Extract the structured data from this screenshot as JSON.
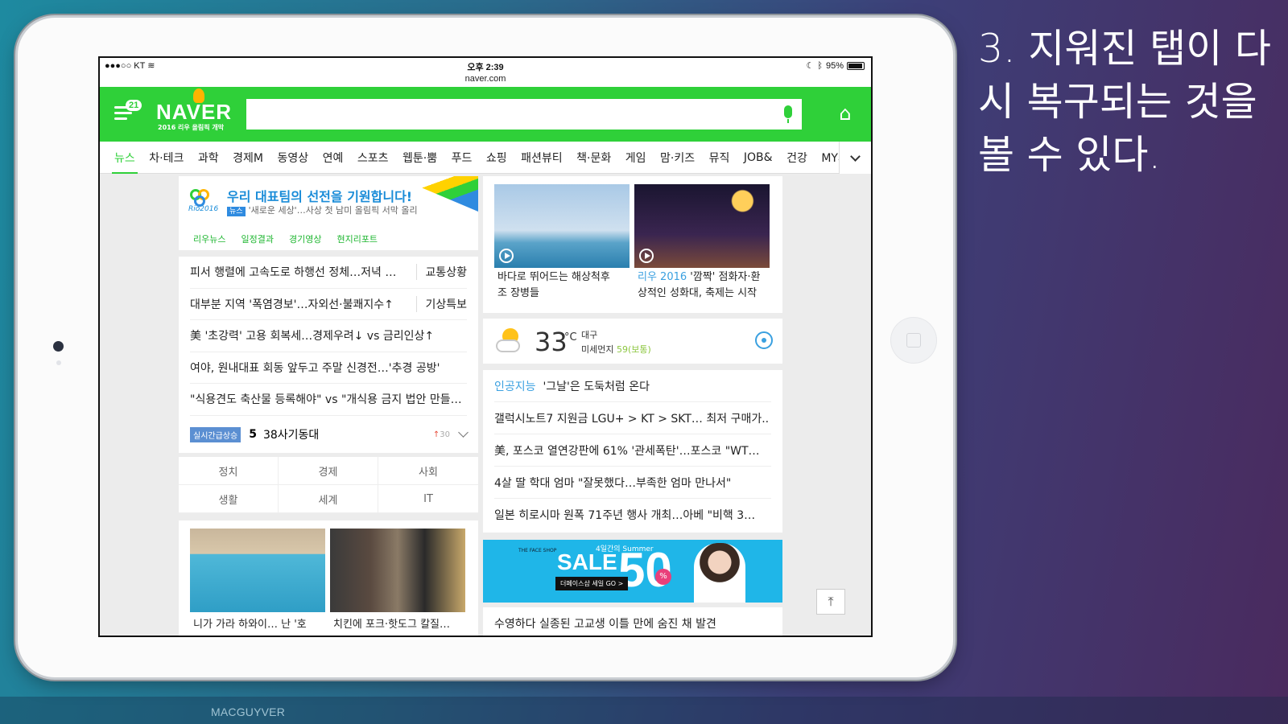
{
  "caption": "3. 지워진 탭이 다시 복구되는 것을 볼 수 있다.",
  "footer": "MACGUYVER",
  "statusbar": {
    "carrier": "●●●○○ KT",
    "time": "오후 2:39",
    "battery": "95%",
    "battery_level": 0.95
  },
  "url": "naver.com",
  "header": {
    "logo": "NAVER",
    "logo_sub": "2016 리우 올림픽 개막",
    "menu_badge": "21",
    "search_placeholder": ""
  },
  "tabs": [
    "뉴스",
    "차·테크",
    "과학",
    "경제M",
    "동영상",
    "연예",
    "스포츠",
    "웹툰·뿜",
    "푸드",
    "쇼핑",
    "패션뷰티",
    "책·문화",
    "게임",
    "맘·키즈",
    "뮤직",
    "JOB&",
    "건강",
    "MY피드"
  ],
  "rio": {
    "logo_text": "Rio2016",
    "title": "우리 대표팀의 선전을 기원합니다!",
    "badge": "뉴스",
    "sub": "'새로운 세상'…사상 첫 남미 올림픽 서막 올리",
    "links": [
      "리우뉴스",
      "일정결과",
      "경기영상",
      "현지리포트"
    ]
  },
  "headlines": [
    {
      "text": "피서 행렬에 고속도로 하행선 정체…저녁 …",
      "tag": "교통상황"
    },
    {
      "text": "대부분 지역 '폭염경보'…자외선·불쾌지수↑",
      "tag": "기상특보"
    },
    {
      "text": "美 '초강력' 고용 회복세…경제우려↓ vs 금리인상↑",
      "tag": ""
    },
    {
      "text": "여야, 원내대표 회동 앞두고 주말 신경전…'추경 공방'",
      "tag": ""
    },
    {
      "text": "\"식용견도 축산물 등록해야\" vs \"개식용 금지 법안 만들…",
      "tag": ""
    }
  ],
  "realtime": {
    "badge": "실시간급상승",
    "rank": "5",
    "keyword": "38사기동대",
    "change": "30"
  },
  "categories": [
    "정치",
    "경제",
    "사회",
    "생활",
    "세계",
    "IT"
  ],
  "photos_left": [
    {
      "caption": "니가 가라 하와이… 난 '호"
    },
    {
      "caption": "치킨에 포크·핫도그 칼질…"
    }
  ],
  "photos_right": [
    {
      "caption_line1": "바다로 뛰어드는 해상척후",
      "caption_line2": "조 장병들"
    },
    {
      "highlight": "리우 2016",
      "caption_line1": "'깜짝' 점화자·환",
      "caption_line2": "상적인 성화대, 축제는 시작"
    }
  ],
  "weather": {
    "temp": "33",
    "unit": "°C",
    "city": "대구",
    "dust_label": "미세먼지",
    "dust_value": "59(보통)"
  },
  "news_right": [
    {
      "highlight": "인공지능",
      "text": "'그날'은 도둑처럼 온다"
    },
    {
      "highlight": "",
      "text": "갤럭시노트7 지원금 LGU+ > KT > SKT… 최저 구매가.."
    },
    {
      "highlight": "",
      "text": "美, 포스코 열연강판에 61% '관세폭탄'…포스코 \"WT…"
    },
    {
      "highlight": "",
      "text": "4살 딸 학대 엄마 \"잘못했다…부족한 엄마 만나서\""
    },
    {
      "highlight": "",
      "text": "일본 히로시마 원폭 71주년 행사 개최…아베 \"비핵 3…"
    }
  ],
  "ad": {
    "shop": "THE FACE SHOP",
    "summer": "4일간의 Summer",
    "sale": "SALE",
    "number": "50",
    "pct": "%",
    "button": "더페이스샵 세일 GO >"
  },
  "bottom_cut": "수영하다 실종된 고교생 이틀 만에 숨진 채 발견",
  "colors": {
    "naver_green": "#2fd039",
    "link_blue": "#3aa0e0",
    "rt_badge": "#5b8fd2"
  },
  "icons": {
    "menu": "menu-icon",
    "mic": "mic-icon",
    "home_add": "home-add-icon",
    "more": "chevron-down-icon",
    "top": "arrow-up-icon",
    "location": "location-icon"
  }
}
